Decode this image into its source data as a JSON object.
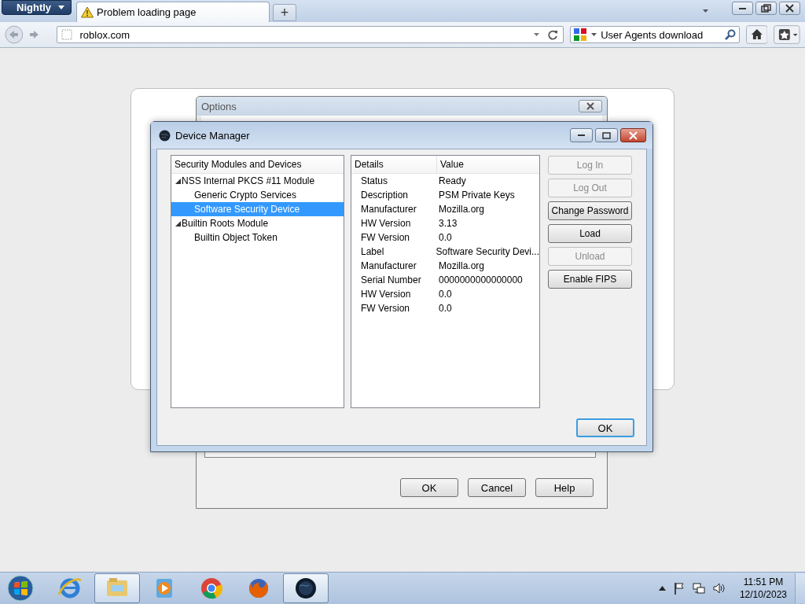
{
  "browser": {
    "menu_button": "Nightly",
    "tabs": [
      {
        "title": "Problem loading page",
        "selected": true
      }
    ],
    "new_tab": "+",
    "address": "roblox.com",
    "search": "User Agents download"
  },
  "options_window": {
    "title": "Options",
    "buttons": [
      "OK",
      "Cancel",
      "Help"
    ]
  },
  "device_manager": {
    "title": "Device Manager",
    "tree": {
      "heading": "Security Modules and Devices",
      "items": [
        {
          "label": "NSS Internal PKCS #11 Module",
          "expanded": true,
          "selected": false,
          "children": [
            {
              "label": "Generic Crypto Services",
              "selected": false
            },
            {
              "label": "Software Security Device",
              "selected": true
            }
          ]
        },
        {
          "label": "Builtin Roots Module",
          "expanded": true,
          "selected": false,
          "children": [
            {
              "label": "Builtin Object Token",
              "selected": false
            }
          ]
        }
      ]
    },
    "details": {
      "columns": [
        "Details",
        "Value"
      ],
      "rows": [
        {
          "name": "Status",
          "value": "Ready"
        },
        {
          "name": "Description",
          "value": "PSM Private Keys"
        },
        {
          "name": "Manufacturer",
          "value": "Mozilla.org"
        },
        {
          "name": "HW Version",
          "value": "3.13"
        },
        {
          "name": "FW Version",
          "value": "0.0"
        },
        {
          "name": "Label",
          "value": "Software Security Devi..."
        },
        {
          "name": "Manufacturer",
          "value": "Mozilla.org"
        },
        {
          "name": "Serial Number",
          "value": "0000000000000000"
        },
        {
          "name": "HW Version",
          "value": "0.0"
        },
        {
          "name": "FW Version",
          "value": "0.0"
        }
      ]
    },
    "actions": [
      {
        "label": "Log In",
        "disabled": true
      },
      {
        "label": "Log Out",
        "disabled": true
      },
      {
        "label": "Change Password",
        "disabled": false
      },
      {
        "label": "Load",
        "disabled": false
      },
      {
        "label": "Unload",
        "disabled": true
      },
      {
        "label": "Enable FIPS",
        "disabled": false
      }
    ],
    "ok": "OK"
  },
  "taskbar": {
    "apps": [
      {
        "kind": "ie",
        "active": false
      },
      {
        "kind": "folder",
        "active": true
      },
      {
        "kind": "media",
        "active": false
      },
      {
        "kind": "chrome",
        "active": false
      },
      {
        "kind": "firefox",
        "active": false
      },
      {
        "kind": "nightly",
        "active": true
      }
    ],
    "time": "11:51 PM",
    "date": "12/10/2023"
  }
}
